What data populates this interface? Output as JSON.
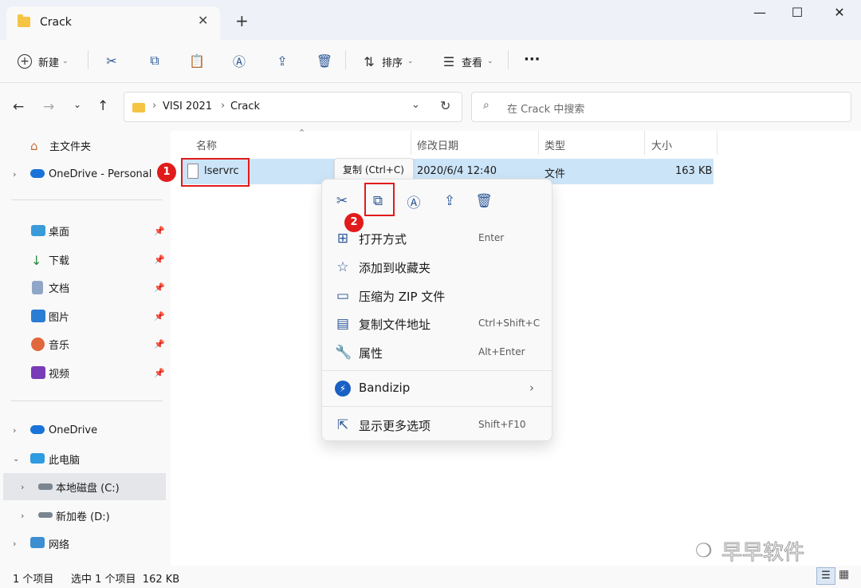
{
  "tab": {
    "title": "Crack",
    "close": "✕",
    "new_tab": "+"
  },
  "window": {
    "minimize": "—",
    "maximize": "☐",
    "close": "✕"
  },
  "toolbar": {
    "new_label": "新建",
    "sort_label": "排序",
    "view_label": "查看",
    "more": "···"
  },
  "address": {
    "path": [
      "VISI 2021",
      "Crack"
    ],
    "separator": "›"
  },
  "search": {
    "placeholder": "在 Crack 中搜索"
  },
  "sidebar": {
    "home": "主文件夹",
    "onedrive_personal": "OneDrive - Personal",
    "quick": [
      {
        "label": "桌面",
        "icon": "desktop-icon"
      },
      {
        "label": "下载",
        "icon": "download-icon"
      },
      {
        "label": "文档",
        "icon": "document-icon"
      },
      {
        "label": "图片",
        "icon": "pictures-icon"
      },
      {
        "label": "音乐",
        "icon": "music-icon"
      },
      {
        "label": "视频",
        "icon": "videos-icon"
      }
    ],
    "onedrive": "OneDrive",
    "this_pc": "此电脑",
    "drive_c": "本地磁盘 (C:)",
    "drive_d": "新加卷 (D:)",
    "network": "网络"
  },
  "columns": {
    "name": "名称",
    "modified": "修改日期",
    "type": "类型",
    "size": "大小"
  },
  "file": {
    "name": "lservrc",
    "modified": "2020/6/4 12:40",
    "type": "文件",
    "size": "163 KB"
  },
  "annotations": {
    "step1": "1",
    "step2": "2"
  },
  "tooltip": "复制 (Ctrl+C)",
  "context_menu": {
    "items": [
      {
        "label": "打开方式",
        "key": "Enter"
      },
      {
        "label": "添加到收藏夹",
        "key": ""
      },
      {
        "label": "压缩为 ZIP 文件",
        "key": ""
      },
      {
        "label": "复制文件地址",
        "key": "Ctrl+Shift+C"
      },
      {
        "label": "属性",
        "key": "Alt+Enter"
      }
    ],
    "bandizip": "Bandizip",
    "more_options": "显示更多选项",
    "more_key": "Shift+F10"
  },
  "status": {
    "count": "1 个项目",
    "selected": "选中 1 个项目  162 KB"
  },
  "watermark": "早早软件",
  "colors": {
    "accent": "#0067c0",
    "selection": "#cce4f7",
    "annotation": "#e11b1b"
  }
}
